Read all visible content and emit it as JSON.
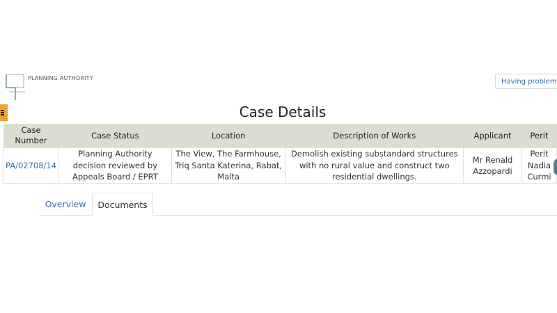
{
  "header": {
    "logo_text": "PLANNING AUTHORITY",
    "help_button": "Having problems?",
    "menu_icon": "hamburger-menu-icon"
  },
  "page": {
    "title": "Case Details"
  },
  "table": {
    "columns": [
      "Case Number",
      "Case Status",
      "Location",
      "Description of Works",
      "Applicant",
      "Perit"
    ],
    "row": {
      "case_number": "PA/02708/14",
      "case_status": "Planning Authority decision reviewed by Appeals Board / EPRT",
      "location": "The View, The Farmhouse, Triq Santa Katerina, Rabat, Malta",
      "description": "Demolish existing substandard structures with no rural value and construct two residential dwellings.",
      "applicant": "Mr Renald Azzopardi",
      "perit": "Perit Nadia Curmi"
    }
  },
  "tabs": [
    {
      "label": "Overview",
      "active": false
    },
    {
      "label": "Documents",
      "active": true
    }
  ],
  "colors": {
    "link": "#3a6fa8",
    "header_bg": "#dddcd0",
    "menu_toggle": "#f0a030"
  }
}
